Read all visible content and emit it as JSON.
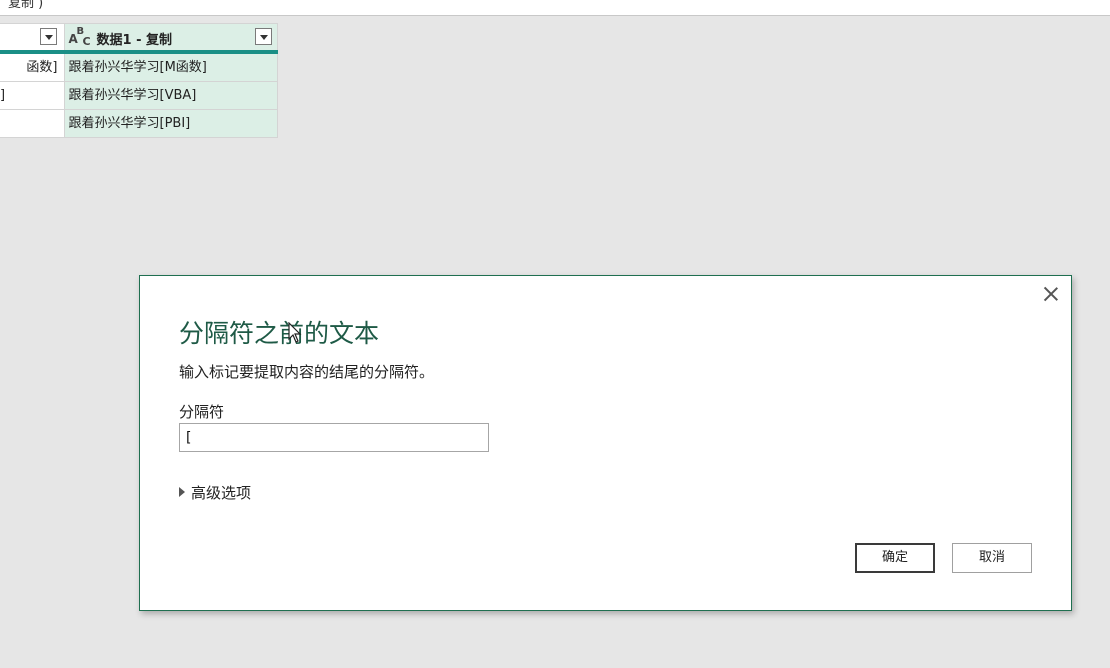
{
  "topbar": {
    "fragment": "复制 )"
  },
  "grid": {
    "column2_header": "数据1 - 复制",
    "column2_type_icon": "ABC-text-type-icon",
    "column1_rows": [
      "函数]",
      "]",
      ""
    ],
    "column2_rows": [
      "跟着孙兴华学习[M函数]",
      "跟着孙兴华学习[VBA]",
      "跟着孙兴华学习[PBI]"
    ]
  },
  "dialog": {
    "title": "分隔符之前的文本",
    "description": "输入标记要提取内容的结尾的分隔符。",
    "delimiter_label": "分隔符",
    "delimiter_value": "[",
    "advanced_label": "高级选项",
    "ok_label": "确定",
    "cancel_label": "取消"
  },
  "colors": {
    "accent": "#1a8f86",
    "column_fill": "#dcefe6",
    "dialog_border": "#1f6f50",
    "title_color": "#1e5a46"
  }
}
